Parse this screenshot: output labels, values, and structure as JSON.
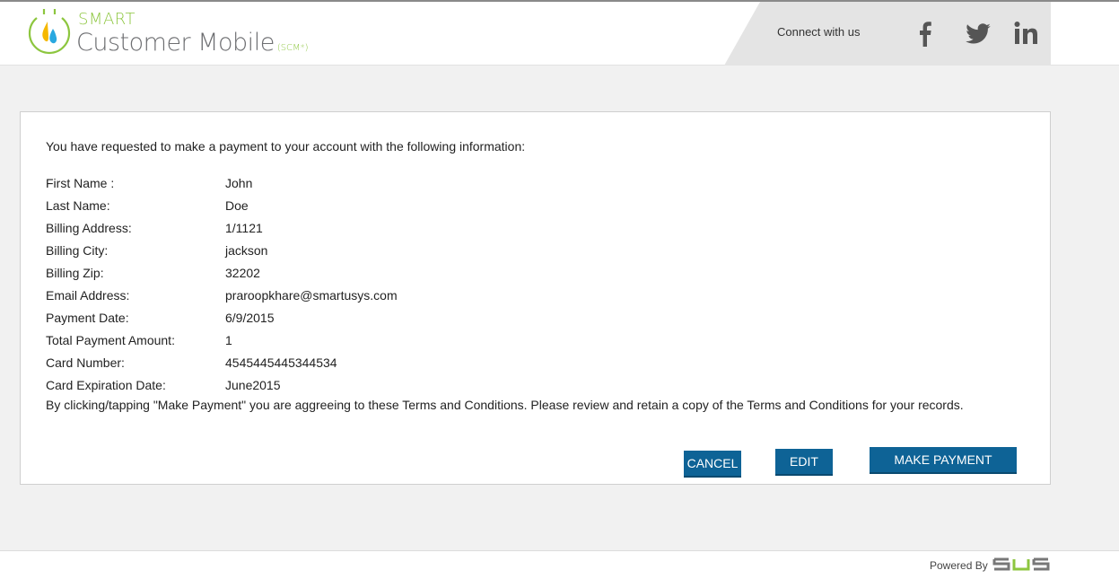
{
  "header": {
    "logo_smart": "SMART",
    "logo_title": "Customer Mobile",
    "logo_suffix": "(SCM*)",
    "connect_label": "Connect with us",
    "social": [
      "facebook-icon",
      "twitter-icon",
      "linkedin-icon"
    ],
    "brand_green": "#8dc63f",
    "brand_gray": "#6d6e71"
  },
  "confirmation": {
    "intro": "You have requested to make a payment to your account with the following information:",
    "fields": [
      {
        "label": "First Name :",
        "value": "John"
      },
      {
        "label": "Last Name:",
        "value": "Doe"
      },
      {
        "label": "Billing Address:",
        "value": "1/1121"
      },
      {
        "label": "Billing City:",
        "value": "jackson"
      },
      {
        "label": "Billing Zip:",
        "value": "32202"
      },
      {
        "label": "Email Address:",
        "value": "praroopkhare@smartusys.com"
      },
      {
        "label": "Payment Date:",
        "value": "6/9/2015"
      },
      {
        "label": "Total Payment Amount:",
        "value": "1"
      },
      {
        "label": "Card Number:",
        "value": "4545445445344534"
      },
      {
        "label": "Card Expiration Date:",
        "value": "June2015"
      }
    ],
    "terms": "By clicking/tapping \"Make Payment\" you are aggreeing to these Terms and Conditions. Please review and retain a copy of the Terms and Conditions for your records."
  },
  "buttons": {
    "cancel": "CANCEL",
    "edit": "EDIT",
    "make_payment": "MAKE PAYMENT",
    "color": "#0e6396"
  },
  "footer": {
    "powered_by": "Powered By",
    "brand": "SUS"
  }
}
